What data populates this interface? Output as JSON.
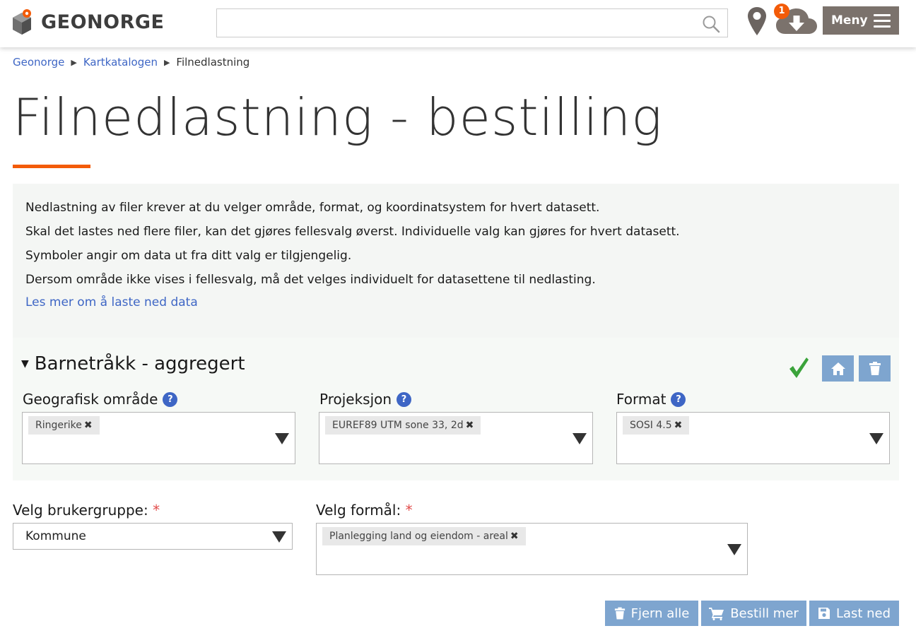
{
  "header": {
    "logo_text": "GEONORGE",
    "search": {
      "value": "",
      "placeholder": ""
    },
    "download_badge": "1",
    "menu_label": "Meny"
  },
  "breadcrumb": {
    "items": [
      "Geonorge",
      "Kartkatalogen"
    ],
    "current": "Filnedlastning"
  },
  "page": {
    "title": "Filnedlastning - bestilling",
    "info_lines": [
      "Nedlastning av filer krever at du velger område, format, og koordinatsystem for hvert datasett.",
      "Skal det lastes ned flere filer, kan det gjøres fellesvalg øverst. Individuelle valg kan gjøres for hvert datasett.",
      "Symboler angir om data ut fra ditt valg er tilgjengelig.",
      "Dersom område ikke vises i fellesvalg, må det velges individuelt for datasettene til nedlasting."
    ],
    "info_link": "Les mer om å laste ned data"
  },
  "dataset": {
    "title": "Barnetråkk - aggregert",
    "fields": [
      {
        "label": "Geografisk område",
        "help": "?",
        "tag": "Ringerike"
      },
      {
        "label": "Projeksjon",
        "help": "?",
        "tag": "EUREF89 UTM sone 33, 2d"
      },
      {
        "label": "Format",
        "help": "?",
        "tag": "SOSI 4.5"
      }
    ],
    "tag_remove": "✖"
  },
  "order": {
    "usergroup_label": "Velg brukergruppe:",
    "usergroup_value": "Kommune",
    "purpose_label": "Velg formål:",
    "purpose_tag": "Planlegging land og eiendom - areal",
    "required_mark": "*"
  },
  "actions": {
    "remove_all": "Fjern alle",
    "order_more": "Bestill mer",
    "download": "Last ned"
  },
  "colors": {
    "accent": "#f35b08",
    "link": "#3e66c5",
    "button": "#7ea5cf",
    "menu_button": "#7b726c",
    "success": "#3aa33a"
  }
}
